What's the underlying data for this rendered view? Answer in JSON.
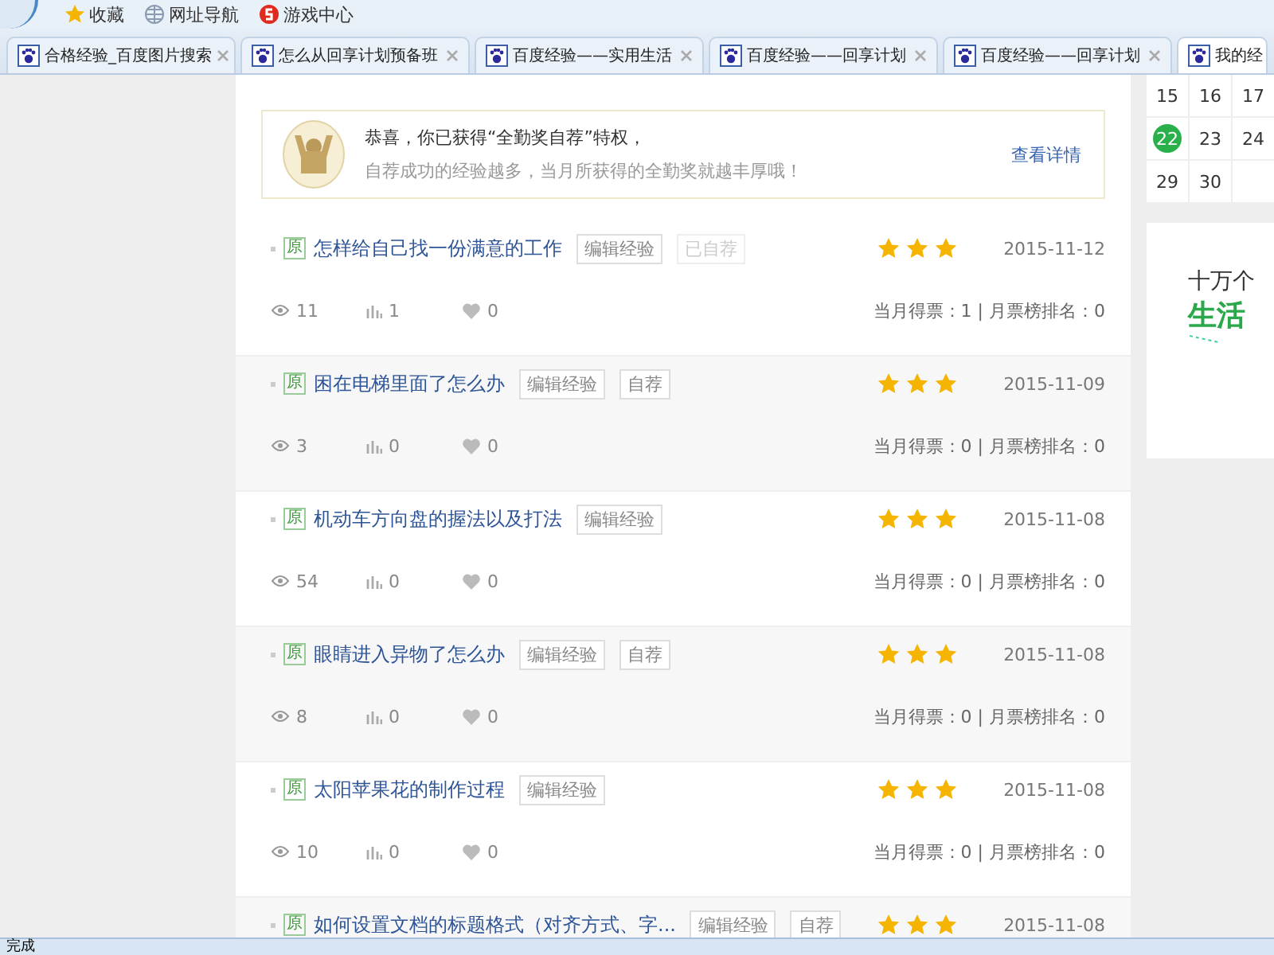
{
  "bookmarks": [
    {
      "label": "收藏",
      "kind": "star"
    },
    {
      "label": "网址导航",
      "kind": "globe"
    },
    {
      "label": "游戏中心",
      "kind": "game"
    }
  ],
  "tabs": [
    {
      "label": "合格经验_百度图片搜索",
      "selected": false
    },
    {
      "label": "怎么从回享计划预备班",
      "selected": false
    },
    {
      "label": "百度经验——实用生活",
      "selected": false
    },
    {
      "label": "百度经验——回享计划",
      "selected": false
    },
    {
      "label": "百度经验——回享计划",
      "selected": false
    },
    {
      "label": "我的经",
      "selected": true
    }
  ],
  "notice": {
    "title": "恭喜，你已获得“全勤奖自荐”特权，",
    "text": "自荐成功的经验越多，当月所获得的全勤奖就越丰厚哦！",
    "link": "查看详情"
  },
  "experiences": [
    {
      "badge": "原",
      "title": "怎样给自己找一份满意的工作",
      "tags": [
        {
          "label": "编辑经验",
          "disabled": false
        },
        {
          "label": "已自荐",
          "disabled": true
        }
      ],
      "stars": 3,
      "date": "2015-11-12",
      "views": "11",
      "votes": "1",
      "likes": "0",
      "monthly": "当月得票：1 | 月票榜排名：0"
    },
    {
      "badge": "原",
      "title": "困在电梯里面了怎么办",
      "tags": [
        {
          "label": "编辑经验",
          "disabled": false
        },
        {
          "label": "自荐",
          "disabled": false
        }
      ],
      "stars": 3,
      "date": "2015-11-09",
      "views": "3",
      "votes": "0",
      "likes": "0",
      "monthly": "当月得票：0 | 月票榜排名：0"
    },
    {
      "badge": "原",
      "title": "机动车方向盘的握法以及打法",
      "tags": [
        {
          "label": "编辑经验",
          "disabled": false
        }
      ],
      "stars": 3,
      "date": "2015-11-08",
      "views": "54",
      "votes": "0",
      "likes": "0",
      "monthly": "当月得票：0 | 月票榜排名：0"
    },
    {
      "badge": "原",
      "title": "眼睛进入异物了怎么办",
      "tags": [
        {
          "label": "编辑经验",
          "disabled": false
        },
        {
          "label": "自荐",
          "disabled": false
        }
      ],
      "stars": 3,
      "date": "2015-11-08",
      "views": "8",
      "votes": "0",
      "likes": "0",
      "monthly": "当月得票：0 | 月票榜排名：0"
    },
    {
      "badge": "原",
      "title": "太阳苹果花的制作过程",
      "tags": [
        {
          "label": "编辑经验",
          "disabled": false
        }
      ],
      "stars": 3,
      "date": "2015-11-08",
      "views": "10",
      "votes": "0",
      "likes": "0",
      "monthly": "当月得票：0 | 月票榜排名：0"
    },
    {
      "badge": "原",
      "title": "如何设置文档的标题格式（对齐方式、字...",
      "tags": [
        {
          "label": "编辑经验",
          "disabled": false
        },
        {
          "label": "自荐",
          "disabled": false
        }
      ],
      "stars": 3,
      "date": "2015-11-08"
    }
  ],
  "calendar": [
    [
      {
        "day": "15",
        "selected": false
      },
      {
        "day": "16",
        "selected": false
      },
      {
        "day": "17",
        "selected": false
      }
    ],
    [
      {
        "day": "22",
        "selected": true
      },
      {
        "day": "23",
        "selected": false
      },
      {
        "day": "24",
        "selected": false
      }
    ],
    [
      {
        "day": "29",
        "selected": false
      },
      {
        "day": "30",
        "selected": false
      }
    ]
  ],
  "banner": {
    "line1": "十万个",
    "line2": "生活"
  },
  "status_bar": "完成"
}
